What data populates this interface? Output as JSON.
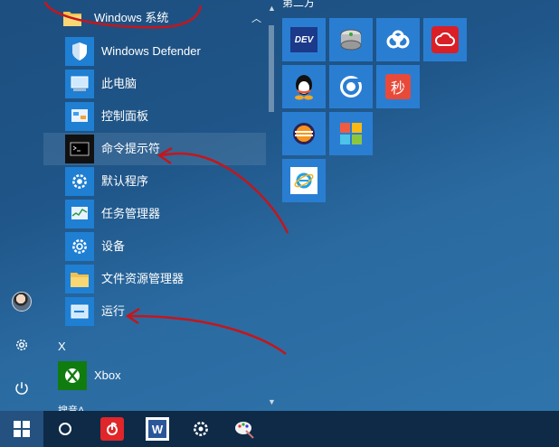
{
  "start_menu": {
    "group": {
      "label": "Windows 系统"
    },
    "items": [
      {
        "label": "Windows Defender",
        "icon": "shield-icon"
      },
      {
        "label": "此电脑",
        "icon": "computer-icon"
      },
      {
        "label": "控制面板",
        "icon": "control-panel-icon"
      },
      {
        "label": "命令提示符",
        "icon": "terminal-icon"
      },
      {
        "label": "默认程序",
        "icon": "gear-icon"
      },
      {
        "label": "任务管理器",
        "icon": "task-manager-icon"
      },
      {
        "label": "设备",
        "icon": "gear-icon"
      },
      {
        "label": "文件资源管理器",
        "icon": "folder-icon"
      },
      {
        "label": "运行",
        "icon": "run-icon"
      }
    ],
    "letter_x": "X",
    "xbox": {
      "label": "Xbox",
      "icon": "xbox-icon"
    },
    "next_letter": "搜音A"
  },
  "tiles": {
    "group_title": "第二方",
    "apps": [
      {
        "icon": "dev-icon",
        "text": "DEV"
      },
      {
        "icon": "disk-icon"
      },
      {
        "icon": "baidu-cloud-icon"
      },
      {
        "icon": "creative-cloud-icon"
      },
      {
        "icon": "qq-icon"
      },
      {
        "icon": "browser-icon"
      },
      {
        "icon": "app-icon"
      },
      {
        "icon": "eclipse-icon"
      },
      {
        "icon": "colorful-icon"
      },
      {
        "icon": "ie-icon"
      }
    ]
  },
  "taskbar": {
    "items": [
      "windows-logo-icon",
      "cortana-icon",
      "netease-music-icon",
      "word-icon",
      "settings-icon",
      "paint-icon"
    ]
  }
}
